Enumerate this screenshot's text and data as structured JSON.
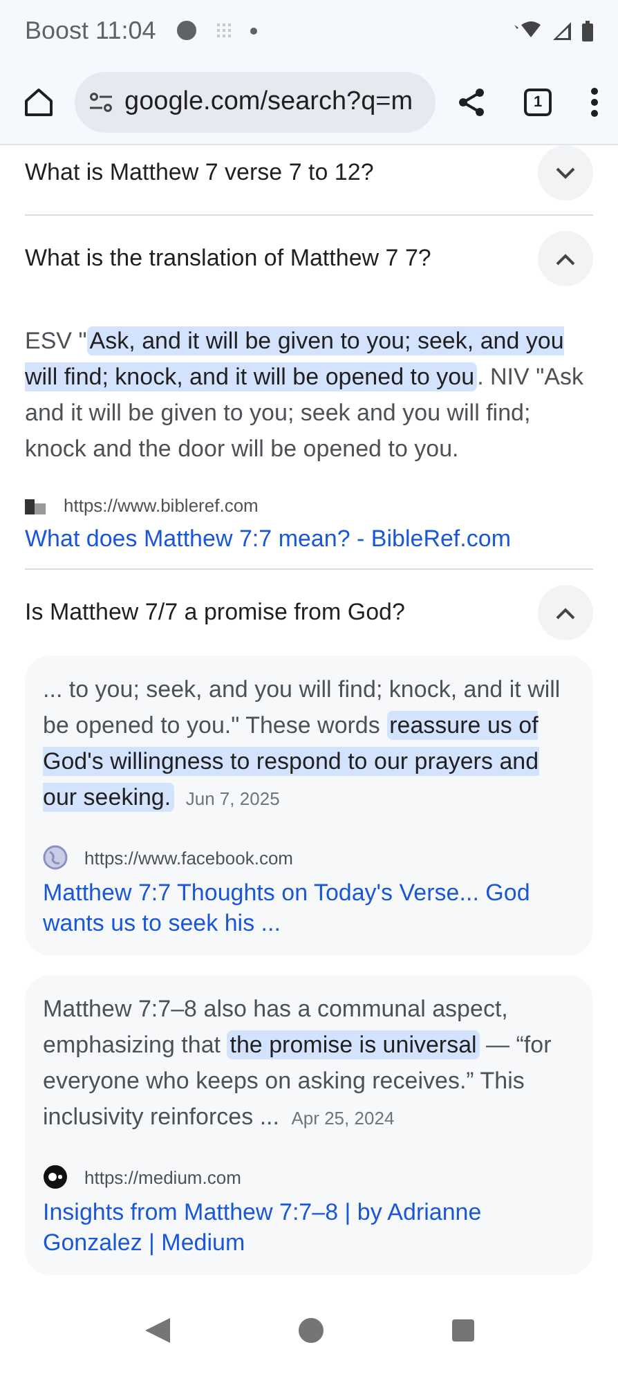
{
  "status_bar": {
    "carrier": "Boost",
    "time": "11:04"
  },
  "toolbar": {
    "url": "google.com/search?q=m",
    "tab_count": "1"
  },
  "faqs": [
    {
      "question": "What is Matthew 7 verse 7 to 12?",
      "expanded": false
    },
    {
      "question": "What is the translation of Matthew 7 7?",
      "expanded": true,
      "answer": {
        "text": "ESV \"**Ask, and it will be given to you; seek, and you will find; knock, and it will be opened to you**. NIV \"Ask and it will be given to you; seek and you will find; knock and the door will be opened to you.",
        "source_url": "https://www.bibleref.com",
        "link": "What does Matthew 7:7 mean? - BibleRef.com"
      }
    },
    {
      "question": "Is Matthew 7/7 a promise from God?",
      "expanded": true,
      "cards": [
        {
          "text": "... to you; seek, and you will find; knock, and it will be opened to you.\" These words **reassure us of God's willingness to respond to our prayers and our seeking.**",
          "date": "Jun 7, 2025",
          "source_url": "https://www.facebook.com",
          "kind": "globe",
          "link": "Matthew 7:7 Thoughts on Today's Verse... God wants us to seek his ..."
        },
        {
          "text": "Matthew 7:7–8 also has a communal aspect, emphasizing that **the promise is universal** — “for everyone who keeps on asking receives.” This inclusivity reinforces ...",
          "date": "Apr 25, 2024",
          "source_url": "https://medium.com",
          "kind": "dark",
          "link": "Insights from Matthew 7:7–8 | by Adrianne Gonzalez | Medium"
        }
      ]
    }
  ]
}
